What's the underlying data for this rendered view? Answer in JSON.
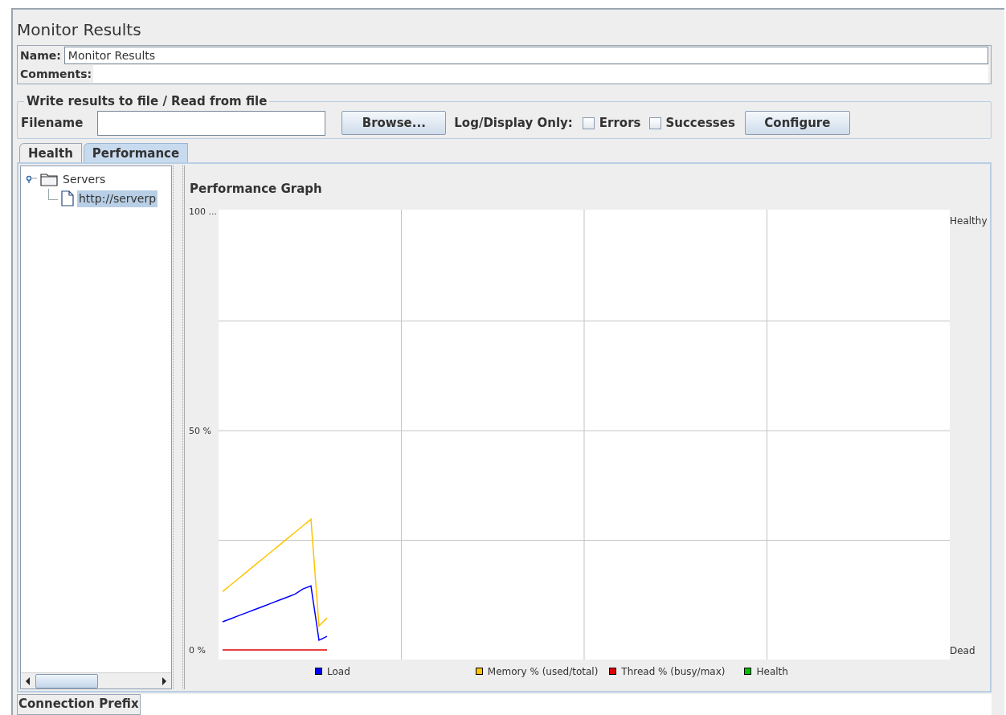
{
  "title": "Monitor Results",
  "name_field": {
    "label": "Name:",
    "value": "Monitor Results"
  },
  "comments_field": {
    "label": "Comments:"
  },
  "file_group": {
    "legend": "Write results to file / Read from file",
    "filename_label": "Filename",
    "browse_button": "Browse...",
    "log_label": "Log/Display Only:",
    "checkboxes": [
      {
        "label": "Errors",
        "checked": false
      },
      {
        "label": "Successes",
        "checked": false
      }
    ],
    "configure_button": "Configure"
  },
  "tabs": [
    {
      "label": "Health",
      "selected": false
    },
    {
      "label": "Performance",
      "selected": true
    }
  ],
  "tree": [
    {
      "label": "Servers",
      "expanded": true,
      "selected": false,
      "children": [
        {
          "label": "http://serverp",
          "selected": true
        }
      ]
    }
  ],
  "graph": {
    "title": "Performance Graph",
    "right_labels": [
      "Healthy",
      "Dead"
    ],
    "chart_data": {
      "type": "line",
      "legend": "bottom",
      "ylim": [
        -2.2,
        100.4
      ],
      "yticks": [
        {
          "value": 0,
          "label": "0 %"
        },
        {
          "value": 50,
          "label": "50 %"
        },
        {
          "value": 100,
          "label": "100 ..."
        }
      ],
      "categories": [
        null,
        null,
        null,
        null,
        null,
        null,
        null,
        null,
        null,
        null,
        null,
        null,
        null,
        null,
        null,
        null,
        null,
        null,
        null,
        null,
        null,
        null,
        null,
        null,
        null,
        null,
        null,
        null,
        null,
        null,
        null,
        null,
        null,
        null,
        null,
        null,
        null,
        null,
        null,
        null,
        null,
        null,
        null,
        null,
        null,
        null,
        null,
        null,
        null,
        null,
        null,
        null,
        null,
        null,
        null,
        null,
        null,
        null,
        null,
        null,
        null,
        null,
        null,
        null,
        null,
        null,
        null,
        null,
        null,
        null,
        null,
        null,
        null,
        null,
        null,
        null,
        null,
        null,
        null,
        null,
        null,
        null,
        null,
        null,
        null,
        null,
        null,
        null,
        null,
        null,
        null
      ],
      "series": [
        {
          "name": "Load",
          "color": "#0000ff",
          "values": [
            6.4,
            7.1,
            7.8,
            8.5,
            9.2,
            9.9,
            10.6,
            11.3,
            12,
            12.7,
            13.9,
            14.6,
            2.2,
            3.1,
            null,
            null,
            null,
            null,
            null,
            null,
            null,
            null,
            null,
            null,
            null,
            null,
            null,
            null,
            null,
            null,
            null,
            null,
            null,
            null,
            null,
            null,
            null,
            null,
            null,
            null,
            null,
            null,
            null,
            null,
            null,
            null,
            null,
            null,
            null,
            null,
            null,
            null,
            null,
            null,
            null,
            null,
            null,
            null,
            null,
            null,
            null,
            null,
            null,
            null,
            null,
            null,
            null,
            null,
            null,
            null,
            null,
            null,
            null,
            null,
            null,
            null,
            null,
            null,
            null,
            null,
            null,
            null,
            null,
            null,
            null,
            null,
            null,
            null,
            null,
            null,
            null
          ]
        },
        {
          "name": "Memory % (used/total)",
          "color": "#ffc400",
          "values": [
            13.3,
            14.8,
            16.3,
            17.8,
            19.3,
            20.8,
            22.3,
            23.8,
            25.3,
            26.8,
            28.3,
            29.8,
            5.5,
            7.3,
            null,
            null,
            null,
            null,
            null,
            null,
            null,
            null,
            null,
            null,
            null,
            null,
            null,
            null,
            null,
            null,
            null,
            null,
            null,
            null,
            null,
            null,
            null,
            null,
            null,
            null,
            null,
            null,
            null,
            null,
            null,
            null,
            null,
            null,
            null,
            null,
            null,
            null,
            null,
            null,
            null,
            null,
            null,
            null,
            null,
            null,
            null,
            null,
            null,
            null,
            null,
            null,
            null,
            null,
            null,
            null,
            null,
            null,
            null,
            null,
            null,
            null,
            null,
            null,
            null,
            null,
            null,
            null,
            null,
            null,
            null,
            null,
            null,
            null,
            null,
            null,
            null
          ]
        },
        {
          "name": "Thread % (busy/max)",
          "color": "#e00000",
          "values": [
            0,
            0,
            0,
            0,
            0,
            0,
            0,
            0,
            0,
            0,
            0,
            0,
            0,
            0,
            null,
            null,
            null,
            null,
            null,
            null,
            null,
            null,
            null,
            null,
            null,
            null,
            null,
            null,
            null,
            null,
            null,
            null,
            null,
            null,
            null,
            null,
            null,
            null,
            null,
            null,
            null,
            null,
            null,
            null,
            null,
            null,
            null,
            null,
            null,
            null,
            null,
            null,
            null,
            null,
            null,
            null,
            null,
            null,
            null,
            null,
            null,
            null,
            null,
            null,
            null,
            null,
            null,
            null,
            null,
            null,
            null,
            null,
            null,
            null,
            null,
            null,
            null,
            null,
            null,
            null,
            null,
            null,
            null,
            null,
            null,
            null,
            null,
            null,
            null,
            null,
            null
          ]
        },
        {
          "name": "Health",
          "color": "#00c000",
          "values": [
            null,
            null,
            null,
            null,
            null,
            null,
            null,
            null,
            null,
            null,
            null,
            null,
            null,
            null,
            null,
            null,
            null,
            null,
            null,
            null,
            null,
            null,
            null,
            null,
            null,
            null,
            null,
            null,
            null,
            null,
            null,
            null,
            null,
            null,
            null,
            null,
            null,
            null,
            null,
            null,
            null,
            null,
            null,
            null,
            null,
            null,
            null,
            null,
            null,
            null,
            null,
            null,
            null,
            null,
            null,
            null,
            null,
            null,
            null,
            null,
            null,
            null,
            null,
            null,
            null,
            null,
            null,
            null,
            null,
            null,
            null,
            null,
            null,
            null,
            null,
            null,
            null,
            null,
            null,
            null,
            null,
            null,
            null,
            null,
            null,
            null,
            null,
            null,
            null,
            null,
            null
          ]
        }
      ]
    }
  },
  "connection_prefix": {
    "label": "Connection Prefix"
  }
}
